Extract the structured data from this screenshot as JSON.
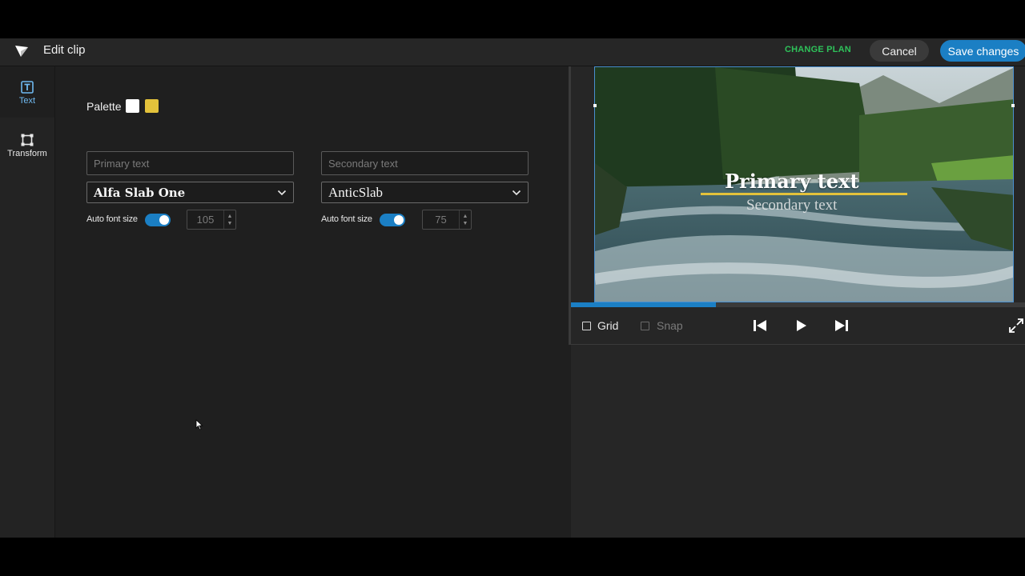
{
  "header": {
    "title": "Edit clip",
    "change_plan": "CHANGE PLAN",
    "cancel": "Cancel",
    "save": "Save changes"
  },
  "rail": {
    "items": [
      {
        "label": "Text",
        "icon": "text-icon",
        "active": true
      },
      {
        "label": "Transform",
        "icon": "transform-icon",
        "active": false
      }
    ]
  },
  "editor": {
    "palette_label": "Palette",
    "palette_colors": [
      "#ffffff",
      "#e3c23b"
    ],
    "primary": {
      "placeholder": "Primary text",
      "font": "Alfa Slab One",
      "auto_font_label": "Auto font size",
      "auto_font_on": true,
      "size": "105"
    },
    "secondary": {
      "placeholder": "Secondary text",
      "font": "AnticSlab",
      "auto_font_label": "Auto font size",
      "auto_font_on": true,
      "size": "75"
    }
  },
  "preview": {
    "primary_text": "Primary text",
    "secondary_text": "Secondary text",
    "progress": 0.32,
    "grid_label": "Grid",
    "snap_label": "Snap"
  },
  "colors": {
    "accent": "#1b7fc4",
    "change_plan": "#2ec25a",
    "underline": "#e3c23b"
  }
}
